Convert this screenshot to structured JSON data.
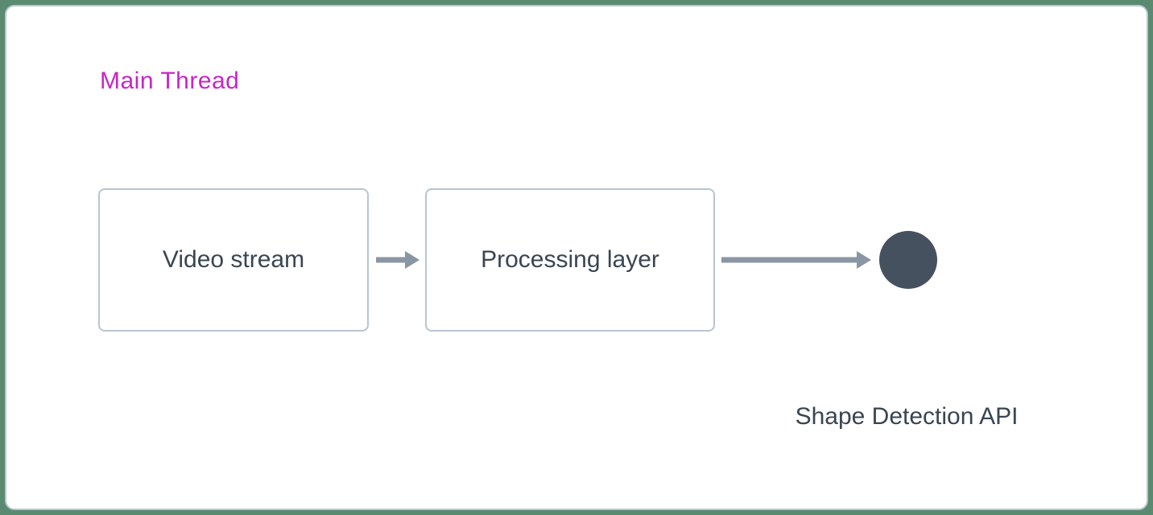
{
  "colors": {
    "border": "#b8c5d1",
    "title": "#c725c7",
    "text": "#3a4552",
    "arrow": "#8a96a3",
    "circle": "#46515f",
    "outer": "#5a8a6f"
  },
  "diagram": {
    "thread_title": "Main Thread",
    "nodes": {
      "video": {
        "label": "Video stream"
      },
      "processing": {
        "label": "Processing layer"
      },
      "api": {
        "label": "Shape Detection API"
      }
    }
  }
}
